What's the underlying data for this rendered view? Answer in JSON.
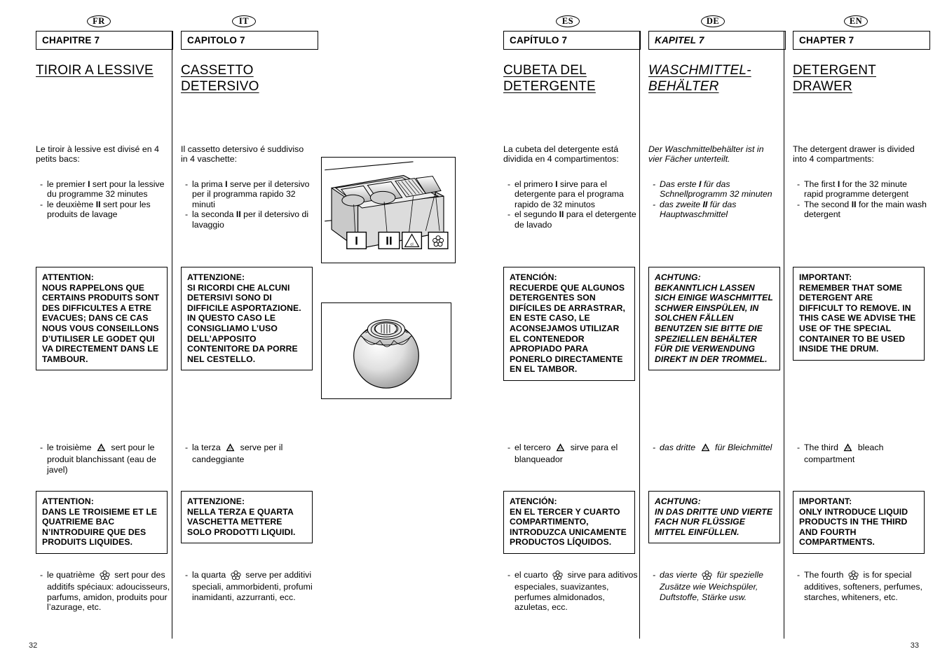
{
  "document": {
    "page_left": "32",
    "page_right": "33"
  },
  "columns": [
    {
      "flag": "FR",
      "chapter": "CHAPITRE 7",
      "title": "TIROIR A LESSIVE",
      "intro": "Le tiroir à lessive est divisé en 4 petits bacs:",
      "bullets": [
        {
          "dash": "-",
          "text_before": "le premier ",
          "marker": "I",
          "text_after": " sert pour la lessive du programme 32 minutes"
        },
        {
          "dash": "-",
          "text_before": "le deuxième ",
          "marker": "II",
          "text_after": " sert pour les produits de lavage"
        }
      ],
      "warning_1_title": "ATTENTION:",
      "warning_1_body": "NOUS RAPPELONS QUE CERTAINS PRODUITS SONT DES DIFFICULTES A ETRE EVACUES; DANS CE CAS NOUS VOUS CONSEILLONS D’UTILISER LE GODET QUI VA DIRECTEMENT DANS LE TAMBOUR.",
      "third_before": "le troisième",
      "third_icon": "bleach-triangle-icon",
      "third_after": "sert pour le produit blanchissant (eau de javel)",
      "warning_2_title": "ATTENTION:",
      "warning_2_body": "DANS LE TROISIEME ET LE QUATRIEME BAC N’INTRODUIRE QUE DES PRODUITS LIQUIDES.",
      "fourth_before": "le quatrième",
      "fourth_icon": "flower-icon",
      "fourth_after": "sert pour des additifs spéciaux: adoucisseurs, parfums, amidon, produits pour l’azurage, etc."
    },
    {
      "flag": "IT",
      "chapter": "CAPITOLO 7",
      "title": "CASSETTO DETERSIVO",
      "intro": "Il cassetto detersivo é suddiviso in 4 vaschette:",
      "bullets": [
        {
          "dash": "-",
          "text_before": "la prima ",
          "marker": "I",
          "text_after": " serve per il detersivo per il programma rapido 32 minuti"
        },
        {
          "dash": "-",
          "text_before": "la seconda ",
          "marker": "II",
          "text_after": " per il detersivo di lavaggio"
        }
      ],
      "warning_1_title": "ATTENZIONE:",
      "warning_1_body": "SI RICORDI CHE ALCUNI DETERSIVI SONO DI DIFFICILE ASPORTAZIONE. IN QUESTO CASO LE CONSIGLIAMO L’USO DELL’APPOSITO CONTENITORE DA PORRE NEL CESTELLO.",
      "third_before": "la terza",
      "third_icon": "bleach-triangle-icon",
      "third_after": "serve per il candeggiante",
      "warning_2_title": "ATTENZIONE:",
      "warning_2_body": "NELLA TERZA E QUARTA VASCHETTA METTERE SOLO PRODOTTI LIQUIDI.",
      "fourth_before": "la quarta",
      "fourth_icon": "flower-icon",
      "fourth_after": "serve per additivi speciali, ammorbidenti, profumi inamidanti, azzurranti, ecc."
    },
    {
      "flag": "ES",
      "chapter": "CAPÍTULO 7",
      "title": "CUBETA DEL DETERGENTE",
      "intro": "La cubeta del detergente está dividida en 4 compartimentos:",
      "bullets": [
        {
          "dash": "-",
          "text_before": "el primero ",
          "marker": "I",
          "text_after": " sirve para el detergente para el programa rapido de 32 minutos"
        },
        {
          "dash": "-",
          "text_before": "el segundo ",
          "marker": "II",
          "text_after": " para el detergente de lavado"
        }
      ],
      "warning_1_title": "ATENCIÓN:",
      "warning_1_body": "RECUERDE QUE ALGUNOS DETERGENTES SON DIFÍCILES DE ARRASTRAR, EN ESTE CASO, LE ACONSEJAMOS UTILIZAR EL CONTENEDOR APROPIADO PARA PONERLO DIRECTAMENTE EN EL TAMBOR.",
      "third_before": "el tercero",
      "third_icon": "bleach-triangle-icon",
      "third_after": "sirve para el blanqueador",
      "warning_2_title": "ATENCIÓN:",
      "warning_2_body": "EN EL TERCER Y CUARTO COMPARTIMENTO, INTRODUZCA UNICAMENTE PRODUCTOS LÍQUIDOS.",
      "fourth_before": "el cuarto",
      "fourth_icon": "flower-icon",
      "fourth_after": "sirve para aditivos especiales, suavizantes, perfumes almidonados, azuletas, ecc."
    },
    {
      "flag": "DE",
      "chapter": "KAPITEL 7",
      "title": "WASCHMITTEL-BEHÄLTER",
      "intro": "Der Waschmittelbehälter ist in vier Fächer unterteilt.",
      "bullets": [
        {
          "dash": "-",
          "text_before": "Das erste ",
          "marker": "I",
          "text_after": " für das Schnellprogramm 32 minuten"
        },
        {
          "dash": "-",
          "text_before": "das zweite ",
          "marker": "II",
          "text_after": " für das Hauptwaschmittel"
        }
      ],
      "warning_1_title": "ACHTUNG:",
      "warning_1_body": "BEKANNTLICH LASSEN SICH EINIGE WASCHMITTEL SCHWER EINSPÜLEN, IN SOLCHEN FÄLLEN BENUTZEN SIE BITTE DIE SPEZIELLEN BEHÄLTER FÜR DIE VERWENDUNG DIREKT IN DER TROMMEL.",
      "third_before": "das dritte",
      "third_icon": "bleach-triangle-icon",
      "third_after": "für Bleichmittel",
      "warning_2_title": "ACHTUNG:",
      "warning_2_body": "IN DAS DRITTE UND VIERTE FACH NUR FLÜSSIGE MITTEL EINFÜLLEN.",
      "fourth_before": "das vierte",
      "fourth_icon": "flower-icon",
      "fourth_after": "für spezielle Zusätze wie Weichspüler, Duftstoffe, Stärke usw."
    },
    {
      "flag": "EN",
      "chapter": "CHAPTER 7",
      "title": "DETERGENT DRAWER",
      "intro": "The detergent drawer is divided into 4 compartments:",
      "bullets": [
        {
          "dash": "-",
          "text_before": "The first ",
          "marker": "I",
          "text_after": " for the 32 minute rapid programme detergent"
        },
        {
          "dash": "-",
          "text_before": "The second ",
          "marker": "II",
          "text_after": " for the main wash detergent"
        }
      ],
      "warning_1_title": "IMPORTANT:",
      "warning_1_body": "REMEMBER THAT SOME DETERGENT ARE DIFFICULT TO REMOVE. IN THIS CASE WE ADVISE THE USE OF THE SPECIAL CONTAINER TO BE USED INSIDE THE DRUM.",
      "third_before": "The third",
      "third_icon": "bleach-triangle-icon",
      "third_after": "bleach compartment",
      "warning_2_title": "IMPORTANT:",
      "warning_2_body": "ONLY INTRODUCE LIQUID PRODUCTS IN THE THIRD AND FOURTH COMPARTMENTS.",
      "fourth_before": "The fourth",
      "fourth_icon": "flower-icon",
      "fourth_after": "is for special additives, softeners, perfumes, starches, whiteners, etc."
    }
  ],
  "illustrations": {
    "drawer": {
      "name": "detergent-drawer-illustration",
      "callouts": [
        "I",
        "II",
        "bleach-triangle-icon",
        "flower-icon"
      ]
    },
    "ball": {
      "name": "detergent-dispenser-ball-illustration"
    }
  }
}
